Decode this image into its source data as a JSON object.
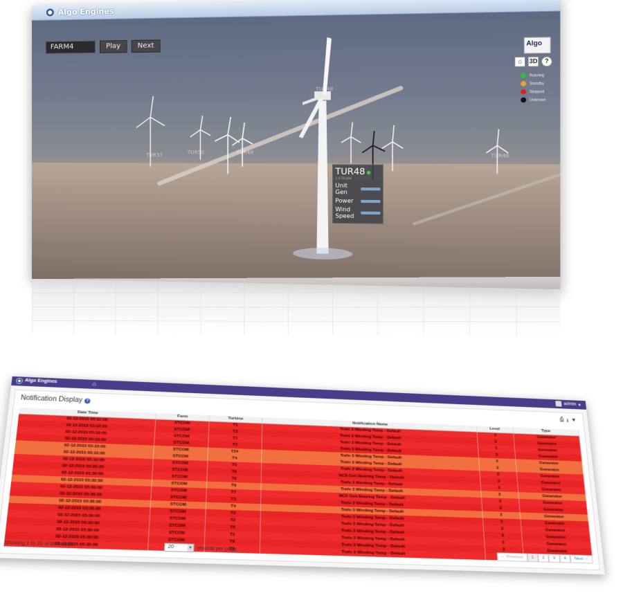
{
  "viewer": {
    "app_title": "Algo Engines",
    "farm_select_value": "FARM4",
    "play_label": "Play",
    "next_label": "Next",
    "logo_text": "Algo",
    "view_buttons": [
      "⌂",
      "3D",
      "?"
    ],
    "legend": [
      {
        "label": "Running",
        "color": "#2fbf3a"
      },
      {
        "label": "Standby",
        "color": "#f0a030"
      },
      {
        "label": "Stopped",
        "color": "#e02020"
      },
      {
        "label": "Unknown",
        "color": "#111111"
      }
    ],
    "turbine_labels": [
      "TUR37",
      "TUR50",
      "TUR49",
      "TUR48",
      "TUR46"
    ],
    "popup": {
      "title": "TUR48",
      "subtitle": "1.4 TR.604",
      "rows": [
        "Unit Gen",
        "Power",
        "Wind Speed"
      ]
    }
  },
  "notify": {
    "app_title": "Algo Engines",
    "user": "admin",
    "panel_title": "Notification Display",
    "columns": [
      "Date Time",
      "Farm",
      "Turbine",
      "Notification Name",
      "Level",
      "Type"
    ],
    "rows": [
      [
        "02-12-2015 05:10:00",
        "STCOM",
        "T1",
        "Trafo 3 Winding Temp - Default",
        "3",
        "Generator"
      ],
      [
        "02-12-2015 05:10:00",
        "STCOM",
        "T3",
        "Trafo 3 Winding Temp - Default",
        "3",
        "Generator"
      ],
      [
        "02-12-2015 05:10:00",
        "STCOM",
        "T1",
        "Trafo 3 Winding Temp - Default",
        "3",
        "Generator"
      ],
      [
        "02-12-2015 05:10:00",
        "STCOM",
        "T2",
        "Trafo 3 Winding Temp - Default",
        "3",
        "Generator"
      ],
      [
        "02-12-2015 05:10:00",
        "STCOM",
        "T24",
        "Trafo 3 Winding Temp - Default",
        "2",
        "Generator"
      ],
      [
        "02-12-2015 05:10:00",
        "STCOM",
        "T4",
        "Trafo 3 Winding Temp - Default",
        "2",
        "Generator"
      ],
      [
        "02-12-2015 05:10:00",
        "STCOM",
        "T5",
        "Trafo 3 Winding Temp - Default",
        "3",
        "Generator"
      ],
      [
        "02-12-2015 05:20:00",
        "STCOM",
        "T6",
        "NCS Gen Bearing Temp - Default",
        "3",
        "Generator"
      ],
      [
        "02-12-2015 05:30:00",
        "STCOM",
        "T6",
        "Trafo 3 Winding Temp - Default",
        "3",
        "Generator"
      ],
      [
        "02-12-2015 05:30:00",
        "STCOM",
        "T9",
        "Trafo 3 Winding Temp - Default",
        "2",
        "Generator"
      ],
      [
        "02-12-2015 05:30:00",
        "STCOM",
        "T7",
        "NCS Gen Bearing Temp - Default",
        "3",
        "Generator"
      ],
      [
        "02-12-2015 05:30:00",
        "STCOM",
        "T3",
        "Trafo 3 Winding Temp - Default",
        "3",
        "Generator"
      ],
      [
        "02-12-2015 05:30:00",
        "STCOM",
        "T4",
        "Trafo 3 Winding Temp - Default",
        "2",
        "Generator"
      ],
      [
        "02-12-2015 05:30:00",
        "STCOM",
        "T5",
        "Trafo 3 Winding Temp - Default",
        "3",
        "Generator"
      ],
      [
        "02-12-2015 05:30:00",
        "STCOM",
        "T2",
        "Trafo 3 Winding Temp - Default",
        "3",
        "Generator"
      ],
      [
        "02-12-2015 05:30:00",
        "STCOM",
        "T6",
        "Trafo 3 Winding Temp - Default",
        "3",
        "Generator"
      ],
      [
        "02-12-2015 05:30:00",
        "STCOM",
        "T1",
        "Trafo 3 Winding Temp - Default",
        "3",
        "Generator"
      ],
      [
        "02-12-2015 05:30:00",
        "STCOM",
        "T2",
        "Trafo 3 Winding Temp - Default",
        "3",
        "Generator"
      ],
      [
        "02-12-2015 05:30:00",
        "STCOM",
        "T3",
        "Trafo 3 Winding Temp - Default",
        "3",
        "Generator"
      ]
    ],
    "showing_text": "Showing 1 to 20 of 80 entries",
    "per_page_value": "20",
    "per_page_label": "records per page",
    "pager": {
      "prev": "← Previous",
      "pages": [
        "1",
        "2",
        "3",
        "4"
      ],
      "next": "Next →"
    }
  }
}
